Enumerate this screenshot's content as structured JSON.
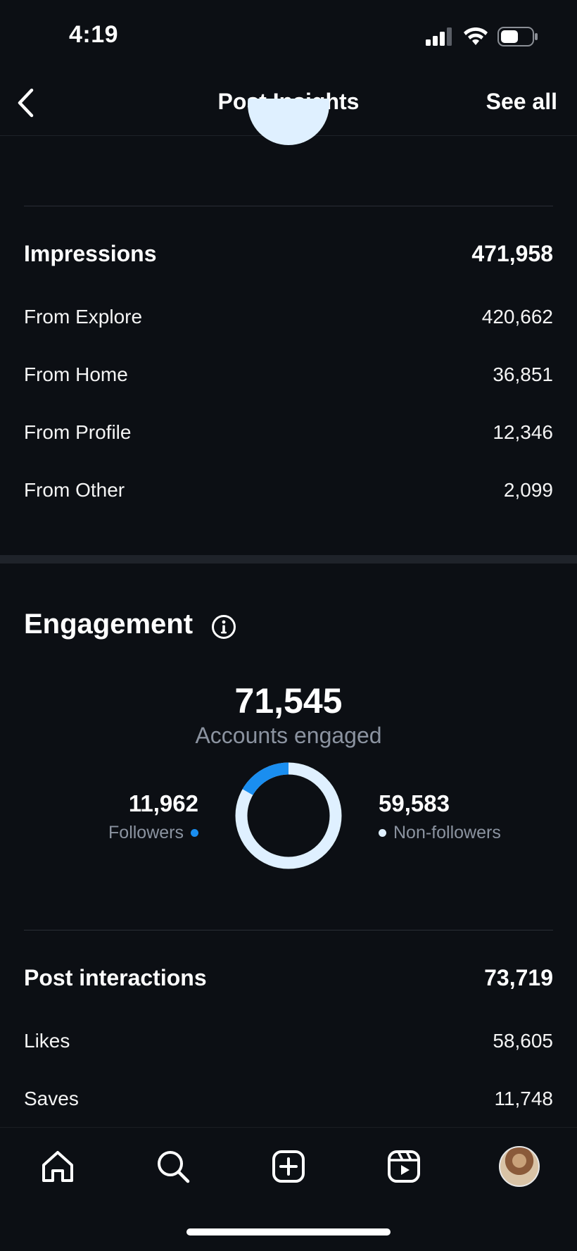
{
  "status_bar": {
    "time": "4:19"
  },
  "header": {
    "title": "Post Insights",
    "see_all": "See all"
  },
  "impressions": {
    "label": "Impressions",
    "total": "471,958",
    "rows": [
      {
        "label": "From Explore",
        "value": "420,662"
      },
      {
        "label": "From Home",
        "value": "36,851"
      },
      {
        "label": "From Profile",
        "value": "12,346"
      },
      {
        "label": "From Other",
        "value": "2,099"
      }
    ]
  },
  "engagement": {
    "title": "Engagement",
    "accounts_engaged": "71,545",
    "accounts_engaged_label": "Accounts engaged",
    "followers": {
      "value": "11,962",
      "label": "Followers",
      "color": "#1a8ef0"
    },
    "non_followers": {
      "value": "59,583",
      "label": "Non-followers",
      "color": "#dff0ff"
    },
    "followers_fraction": 0.167
  },
  "post_interactions": {
    "label": "Post interactions",
    "total": "73,719",
    "rows": [
      {
        "label": "Likes",
        "value": "58,605"
      },
      {
        "label": "Saves",
        "value": "11,748"
      }
    ]
  },
  "tab_bar": {
    "items": [
      "home-icon",
      "search-icon",
      "create-icon",
      "reels-icon",
      "profile-avatar"
    ]
  }
}
